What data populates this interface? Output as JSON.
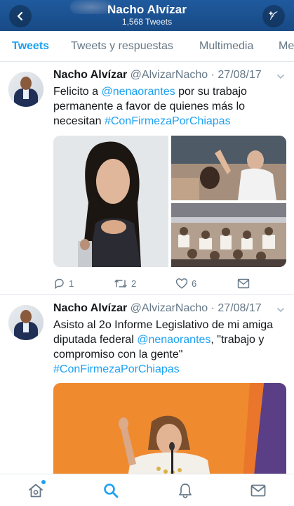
{
  "header": {
    "name": "Nacho Alvízar",
    "tweet_count": "1,568 Tweets"
  },
  "tabs": [
    {
      "label": "Tweets",
      "active": true
    },
    {
      "label": "Tweets y respuestas",
      "active": false
    },
    {
      "label": "Multimedia",
      "active": false
    },
    {
      "label": "Me",
      "active": false
    }
  ],
  "tweets": [
    {
      "name": "Nacho Alvízar",
      "handle": "@AlvizarNacho",
      "date": "· 27/08/17",
      "text_parts": [
        "Felicito a ",
        "@nenaorantes",
        " por su trabajo permanente a favor de quienes más lo necesitan ",
        "#ConFirmezaPorChiapas"
      ],
      "replies": "1",
      "retweets": "2",
      "likes": "6"
    },
    {
      "name": "Nacho Alvízar",
      "handle": "@AlvizarNacho",
      "date": "· 27/08/17",
      "text_parts": [
        "Asisto al 2o Informe Legislativo de mi amiga diputada federal ",
        "@nenaorantes",
        ", \"trabajo y compromiso con la gente\" ",
        "#ConFirmezaPorChiapas"
      ]
    }
  ],
  "colors": {
    "header": "#1f5a9e",
    "accent": "#1da1f2",
    "muted": "#657786",
    "text": "#14171a"
  },
  "bottom_nav": [
    "home-icon",
    "search-icon",
    "bell-icon",
    "mail-icon"
  ]
}
